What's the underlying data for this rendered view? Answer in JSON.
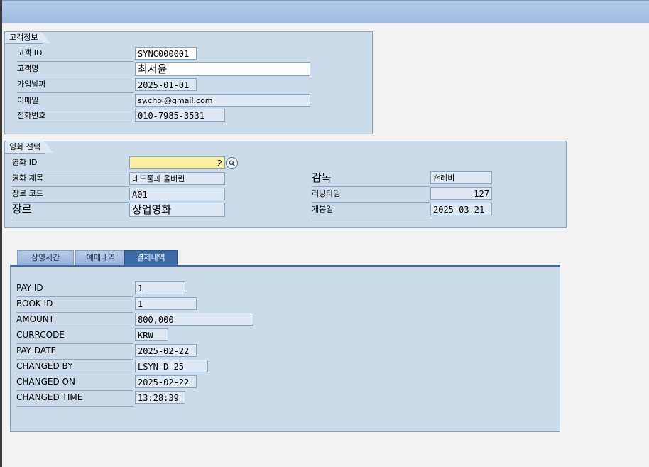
{
  "customer": {
    "title": "고객정보",
    "rows": [
      {
        "label": "고객 ID",
        "value": "SYNC000001"
      },
      {
        "label": "고객명",
        "value": "최서윤"
      },
      {
        "label": "가입날짜",
        "value": "2025-01-01"
      },
      {
        "label": "이메일",
        "value": "sy.choi@gmail.com"
      },
      {
        "label": "전화번호",
        "value": "010-7985-3531"
      }
    ]
  },
  "movie": {
    "title": "영화 선택",
    "id_label": "영화 ID",
    "id_value": "2",
    "title_label": "영화 제목",
    "title_value": "데드풀과 울버린",
    "genre_code_label": "장르 코드",
    "genre_code_value": "A01",
    "genre_label": "장르",
    "genre_value": "상업영화",
    "director_label": "감독",
    "director_value": "숀레비",
    "runtime_label": "러닝타임",
    "runtime_value": "127",
    "release_label": "개봉일",
    "release_value": "2025-03-21"
  },
  "tabs": [
    {
      "label": "상영시간"
    },
    {
      "label": "예매내역"
    },
    {
      "label": "결제내역"
    }
  ],
  "active_tab": "결제내역",
  "payment": {
    "rows": [
      {
        "label": "PAY ID",
        "value": "1"
      },
      {
        "label": "BOOK ID",
        "value": "1"
      },
      {
        "label": "AMOUNT",
        "value": "800,000"
      },
      {
        "label": "CURRCODE",
        "value": "KRW"
      },
      {
        "label": "PAY DATE",
        "value": "2025-02-22"
      },
      {
        "label": "CHANGED BY",
        "value": "LSYN-D-25"
      },
      {
        "label": "CHANGED ON",
        "value": "2025-02-22"
      },
      {
        "label": "CHANGED TIME",
        "value": "13:28:39"
      }
    ]
  },
  "colors": {
    "panel": "#cbdbea",
    "tab_active": "#3a6aa8",
    "input_required": "#fbf0a0"
  }
}
